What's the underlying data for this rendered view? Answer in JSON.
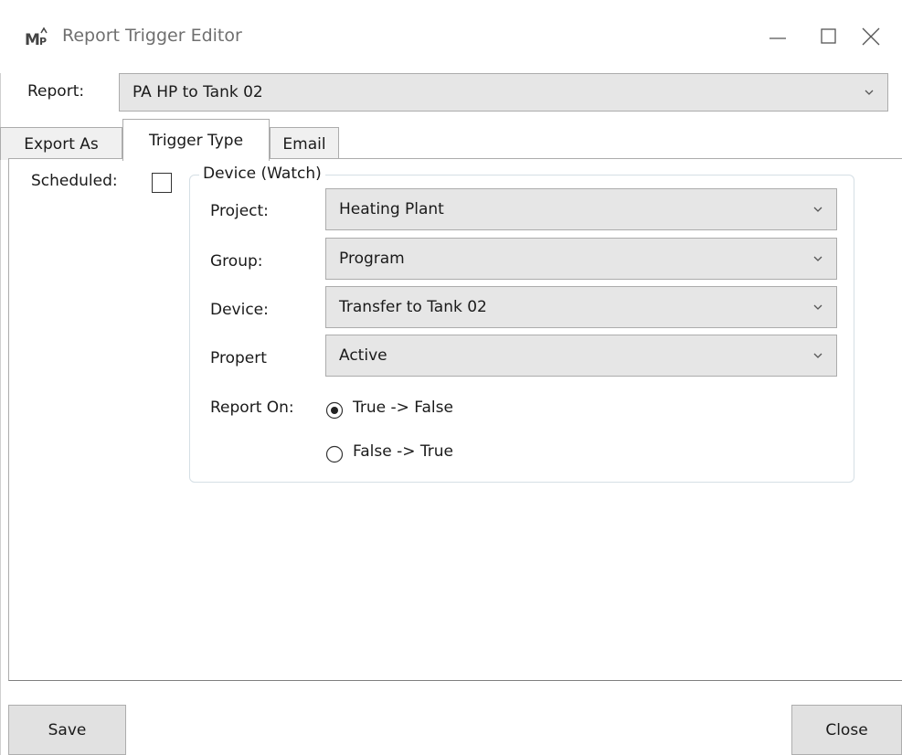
{
  "window": {
    "title": "Report Trigger Editor",
    "app_icon_text": "MP",
    "controls": [
      "minimize",
      "maximize",
      "close"
    ]
  },
  "report": {
    "label": "Report:",
    "selected": "PA HP to Tank 02"
  },
  "tabs": [
    {
      "label": "Export As",
      "active": false
    },
    {
      "label": "Trigger Type",
      "active": true
    },
    {
      "label": "Email",
      "active": false
    }
  ],
  "trigger": {
    "scheduled_label": "Scheduled:",
    "scheduled_checked": false,
    "group_title": "Device (Watch)",
    "project": {
      "label": "Project:",
      "value": "Heating Plant"
    },
    "group": {
      "label": "Group:",
      "value": "Program"
    },
    "device": {
      "label": "Device:",
      "value": "Transfer to Tank 02"
    },
    "property": {
      "label": "Propert",
      "value": "Active"
    },
    "report_on": {
      "label": "Report On:",
      "options": [
        {
          "label": "True -> False",
          "selected": true
        },
        {
          "label": "False -> True",
          "selected": false
        }
      ]
    }
  },
  "buttons": {
    "save": "Save",
    "close": "Close"
  },
  "colors": {
    "combo_bg": "#e6e6e6",
    "border": "#acacac",
    "button_bg": "#e1e1e1",
    "title_text": "#6f6f6f"
  }
}
